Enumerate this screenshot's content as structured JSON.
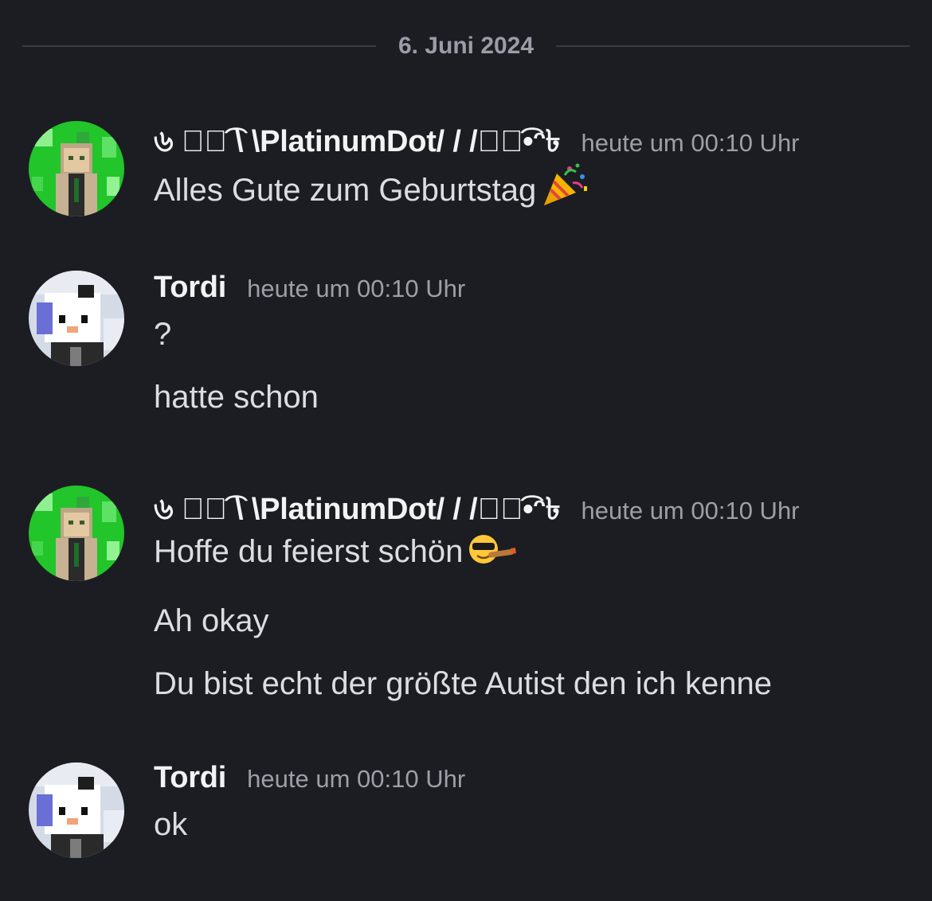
{
  "divider": {
    "date": "6. Juni 2024"
  },
  "groups": [
    {
      "username": "৬ ⵉ⃘͡ \\ \\PlatinumDot/ / /ⵉ⃘͡•ᵔ৳",
      "avatar": "platinum-avatar",
      "timestamp": "heute um 00:10 Uhr",
      "messages": [
        {
          "text": "Alles Gute zum Geburtstag",
          "emoji": "party-popper-icon"
        }
      ]
    },
    {
      "username": "Tordi",
      "avatar": "tordi-avatar",
      "timestamp": "heute um 00:10 Uhr",
      "messages": [
        {
          "text": "?"
        },
        {
          "text": "hatte schon"
        }
      ]
    },
    {
      "username": "৬ ⵉ⃘͡ \\ \\PlatinumDot/ / /ⵉ⃘͡•ᵔ৳",
      "avatar": "platinum-avatar",
      "timestamp": "heute um 00:10 Uhr",
      "messages": [
        {
          "text": "Hoffe du feierst schön",
          "emoji": "cool-face-with-cigar-icon"
        },
        {
          "text": "Ah okay"
        },
        {
          "text": "Du bist echt der größte Autist den ich kenne"
        }
      ]
    },
    {
      "username": "Tordi",
      "avatar": "tordi-avatar",
      "timestamp": "heute um 00:10 Uhr",
      "messages": [
        {
          "text": "ok"
        }
      ]
    }
  ]
}
